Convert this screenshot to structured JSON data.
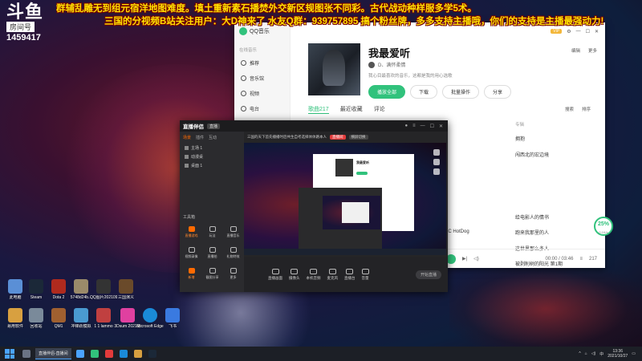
{
  "watermark": {
    "mark": "斗鱼",
    "room_label": "房间号",
    "room_id": "1459417"
  },
  "ticker": {
    "line1": "群辅乱雕无到组元宿洋地图难度。填土重新素石播焚外交新区规图张不同彩。古代战动种样服多学5术。",
    "line2": "三国的分视频B站关注用户：大D神来了 水友Q群：939757895 搞个粉丝牌，多多支持主播哦，你们的支持是主播最强动力!",
    "line3": ""
  },
  "qq_music": {
    "brand": "QQ音乐",
    "vip": "VIP",
    "side_section": "在线音乐",
    "side_items": [
      "推荐",
      "音乐馆",
      "视频",
      "电台"
    ],
    "playlist_title": "我最爱听",
    "creator": "D、满怀柔情",
    "description": "我心目最喜欢的音乐，这都是我的用心选歌",
    "buttons": {
      "play_all": "播放全部",
      "download": "下载",
      "batch": "批量操作",
      "share": "分享"
    },
    "top_right": {
      "edit": "编辑",
      "more": "更多"
    },
    "tabs": [
      "歌曲217",
      "最近收藏",
      "评论"
    ],
    "tools": {
      "search": "搜索",
      "sort": "排序"
    },
    "album_header": "专辑",
    "albums": [
      "拥抱",
      "闯西北的宏边境",
      "",
      "",
      "",
      "给电影人的情书",
      "跑来我那里的人",
      "这世界那么多人",
      "被剥削树的阳光 第1期"
    ],
    "partial_song": "/ MC HotDog",
    "time": "00:00 / 03:46",
    "count": "217",
    "speed_pct": "25%",
    "speed_sub": "0.1K/s"
  },
  "live": {
    "logo": "直播伴侣",
    "tag": "直播",
    "left_tabs": [
      "场景",
      "插件",
      "互动"
    ],
    "scenes": [
      "主场 1",
      "动漫桌",
      "桌面 1"
    ],
    "tools_label": "工具箱",
    "tools": [
      "直播游戏",
      "玩法",
      "直播音乐",
      "视频录像",
      "直播拍",
      "礼物特效",
      "新增",
      "截图分享",
      "更多"
    ],
    "toolbar_text": "三国的天下首先播播时后共生自考选择体体路本人",
    "toolbar_red": "直播间",
    "toolbar_grey": "横屏切换",
    "bottom_items": [
      "直播画面",
      "摄像头",
      "本机音频",
      "麦克风",
      "直播台",
      "音量"
    ],
    "go_button": "开始直播"
  },
  "desktop_icons": [
    {
      "label": "此电脑",
      "color": "#5a8fd6"
    },
    {
      "label": "Steam",
      "color": "#1b2838"
    },
    {
      "label": "Dota 2",
      "color": "#b02a1e"
    },
    {
      "label": "5748d24b...",
      "color": "#9a8a6a"
    },
    {
      "label": "QQ图片20210927",
      "color": "#333"
    },
    {
      "label": "三国演义",
      "color": "#6a4a2a"
    },
    {
      "label": "易用软件",
      "color": "#d8a040"
    },
    {
      "label": "回收站",
      "color": "#7a8a9a"
    },
    {
      "label": "QM1",
      "color": "#a06030"
    },
    {
      "label": "冲锋跃模拟",
      "color": "#4a9ad0"
    },
    {
      "label": "1 1 lammo",
      "color": "#c04040"
    },
    {
      "label": "3Dsum 2021新",
      "color": "#e040a0"
    },
    {
      "label": "Microsoft Edge",
      "color": "#1a8ad8"
    },
    {
      "label": "飞书",
      "color": "#3a7ae0"
    }
  ],
  "taskbar": {
    "task": "直播伴侣-直播间",
    "time": "13:36",
    "date": "2021/10/27",
    "lang": "中"
  }
}
